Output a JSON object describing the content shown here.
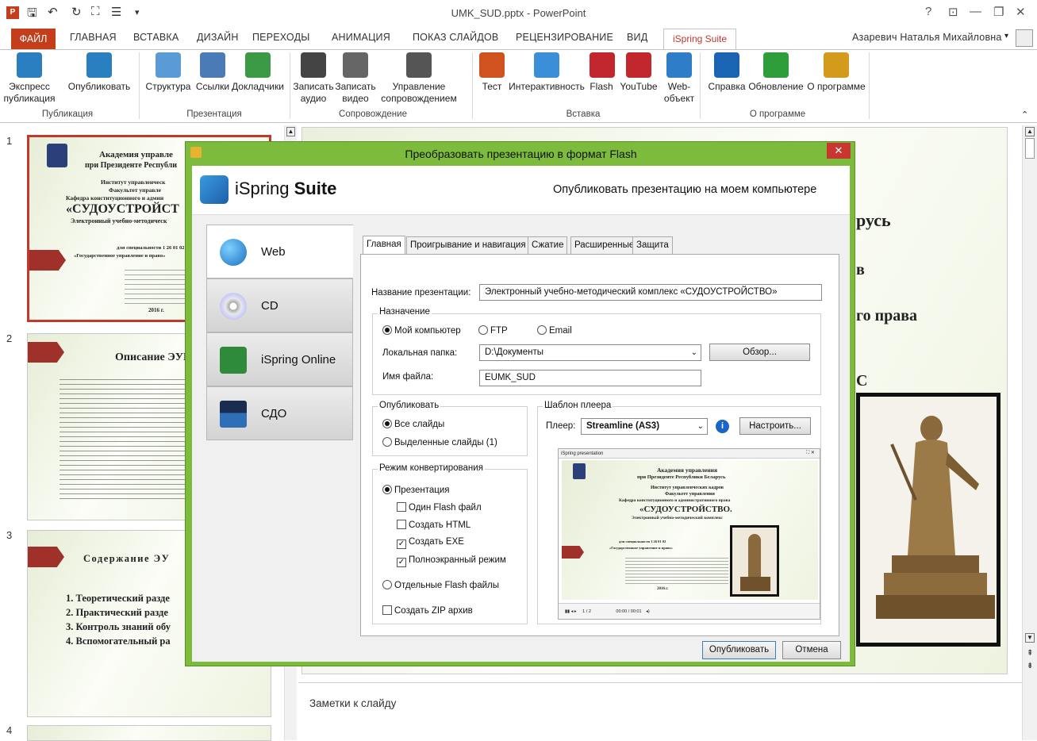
{
  "window": {
    "title": "UMK_SUD.pptx - PowerPoint",
    "controls": [
      "?",
      "⊡",
      "—",
      "❐",
      "✕"
    ]
  },
  "ribbon_tabs": {
    "file": "ФАЙЛ",
    "items": [
      "ГЛАВНАЯ",
      "ВСТАВКА",
      "ДИЗАЙН",
      "ПЕРЕХОДЫ",
      "АНИМАЦИЯ",
      "ПОКАЗ СЛАЙДОВ",
      "РЕЦЕНЗИРОВАНИЕ",
      "ВИД"
    ],
    "active": "iSpring Suite",
    "user": "Азаревич Наталья Михайловна"
  },
  "ribbon": {
    "buttons": [
      {
        "label": "Экспресс публикация",
        "icon": "express-publish-icon",
        "color": "#2a7fc1"
      },
      {
        "label": "Опубликовать",
        "icon": "publish-icon",
        "color": "#2a7fc1"
      },
      {
        "label": "Структура",
        "icon": "structure-icon",
        "color": "#5b9bd5"
      },
      {
        "label": "Ссылки",
        "icon": "links-icon",
        "color": "#4a7bb7"
      },
      {
        "label": "Докладчики",
        "icon": "presenters-icon",
        "color": "#3a9a46"
      },
      {
        "label": "Записать аудио",
        "icon": "microphone-icon",
        "color": "#444444"
      },
      {
        "label": "Записать видео",
        "icon": "webcam-icon",
        "color": "#666666"
      },
      {
        "label": "Управление сопровождением",
        "icon": "timer-icon",
        "color": "#555555"
      },
      {
        "label": "Тест",
        "icon": "quiz-icon",
        "color": "#d0531f"
      },
      {
        "label": "Интерактивность",
        "icon": "interactivity-icon",
        "color": "#3b8ed8"
      },
      {
        "label": "Flash",
        "icon": "flash-icon",
        "color": "#c1272d"
      },
      {
        "label": "YouTube",
        "icon": "youtube-icon",
        "color": "#c1272d"
      },
      {
        "label": "Web-объект",
        "icon": "web-object-icon",
        "color": "#2d7dc8"
      },
      {
        "label": "Справка",
        "icon": "help-icon",
        "color": "#1a64b4"
      },
      {
        "label": "Обновление",
        "icon": "update-icon",
        "color": "#2e9e3b"
      },
      {
        "label": "О программе",
        "icon": "about-icon",
        "color": "#d49a1b"
      }
    ],
    "groups": [
      "Публикация",
      "Презентация",
      "Сопровождение",
      "Вставка",
      "О программе"
    ]
  },
  "thumbnails": {
    "numbers": [
      "1",
      "2",
      "3",
      "4"
    ],
    "s1": {
      "title1": "Академия управле",
      "title2": "при Президенте Республи",
      "line1": "Институт управленческ",
      "line2": "Факультет управле",
      "line3": "Кафедра конституционного и админ",
      "big": "«СУДОУСТРОЙСТ",
      "sub": "Электронный учебно-методическ",
      "spec1": "для специальности 1 26 01 02",
      "spec2": "«Государственное управление и право»",
      "year": "2016 г."
    },
    "s2": {
      "title": "Описание ЭУМ"
    },
    "s3": {
      "title": "Содержание ЭУ",
      "items": [
        "1. Теоретический разде",
        "2. Практический разде",
        "3. Контроль знаний обу",
        "4. Вспомогательный ра"
      ]
    }
  },
  "main_slide": {
    "text1": "русь",
    "text2": "в",
    "text3": "го права",
    "text4": "С"
  },
  "notes": {
    "label": "Заметки к слайду"
  },
  "dialog": {
    "title": "Преобразовать презентацию в формат Flash",
    "brand": "iSpring",
    "brand2": "Suite",
    "subtitle": "Опубликовать презентацию на моем компьютере",
    "nav": [
      {
        "label": "Web",
        "icon": "globe-icon"
      },
      {
        "label": "CD",
        "icon": "cd-icon"
      },
      {
        "label": "iSpring Online",
        "icon": "ispring-online-icon"
      },
      {
        "label": "СДО",
        "icon": "lms-icon"
      }
    ],
    "tabs": [
      "Главная",
      "Проигрывание и навигация",
      "Сжатие",
      "Расширенные",
      "Защита"
    ],
    "title_label": "Название презентации:",
    "title_value": "Электронный учебно-методический комплекс «СУДОУСТРОЙСТВО»",
    "dest_legend": "Назначение",
    "dest_options": [
      "Мой компьютер",
      "FTP",
      "Email"
    ],
    "folder_label": "Локальная папка:",
    "folder_value": "D:\\Документы",
    "browse": "Обзор...",
    "file_label": "Имя файла:",
    "file_value": "EUMK_SUD",
    "publish_legend": "Опубликовать",
    "publish_options": [
      "Все слайды",
      "Выделенные слайды (1)"
    ],
    "mode_legend": "Режим конвертирования",
    "mode_presentation": "Презентация",
    "mode_checks": [
      {
        "label": "Один Flash файл",
        "checked": false
      },
      {
        "label": "Создать HTML",
        "checked": false
      },
      {
        "label": "Создать EXE",
        "checked": true
      },
      {
        "label": "Полноэкранный режим",
        "checked": true
      }
    ],
    "mode_separate": "Отдельные Flash файлы",
    "zip": "Создать ZIP архив",
    "player_legend": "Шаблон плеера",
    "player_label": "Плеер:",
    "player_value": "Streamline (AS3)",
    "configure": "Настроить...",
    "preview": {
      "caption": "iSpring presentation",
      "l1": "Академия управления",
      "l2": "при Президенте Республики Беларусь",
      "l3": "Институт управленческих кадров",
      "l4": "Факультет управления",
      "l5": "Кафедра конституционного и административного права",
      "l6": "«СУДОУСТРОЙСТВО.",
      "l7": "Электронный учебно-методический комплекс",
      "l8": "для специальности 1 26 01 02",
      "l9": "«Государственное управление и право»",
      "l10": "2016 г.",
      "page": "1 / 2",
      "time": "00:00 / 00:01"
    },
    "ok": "Опубликовать",
    "cancel": "Отмена"
  }
}
